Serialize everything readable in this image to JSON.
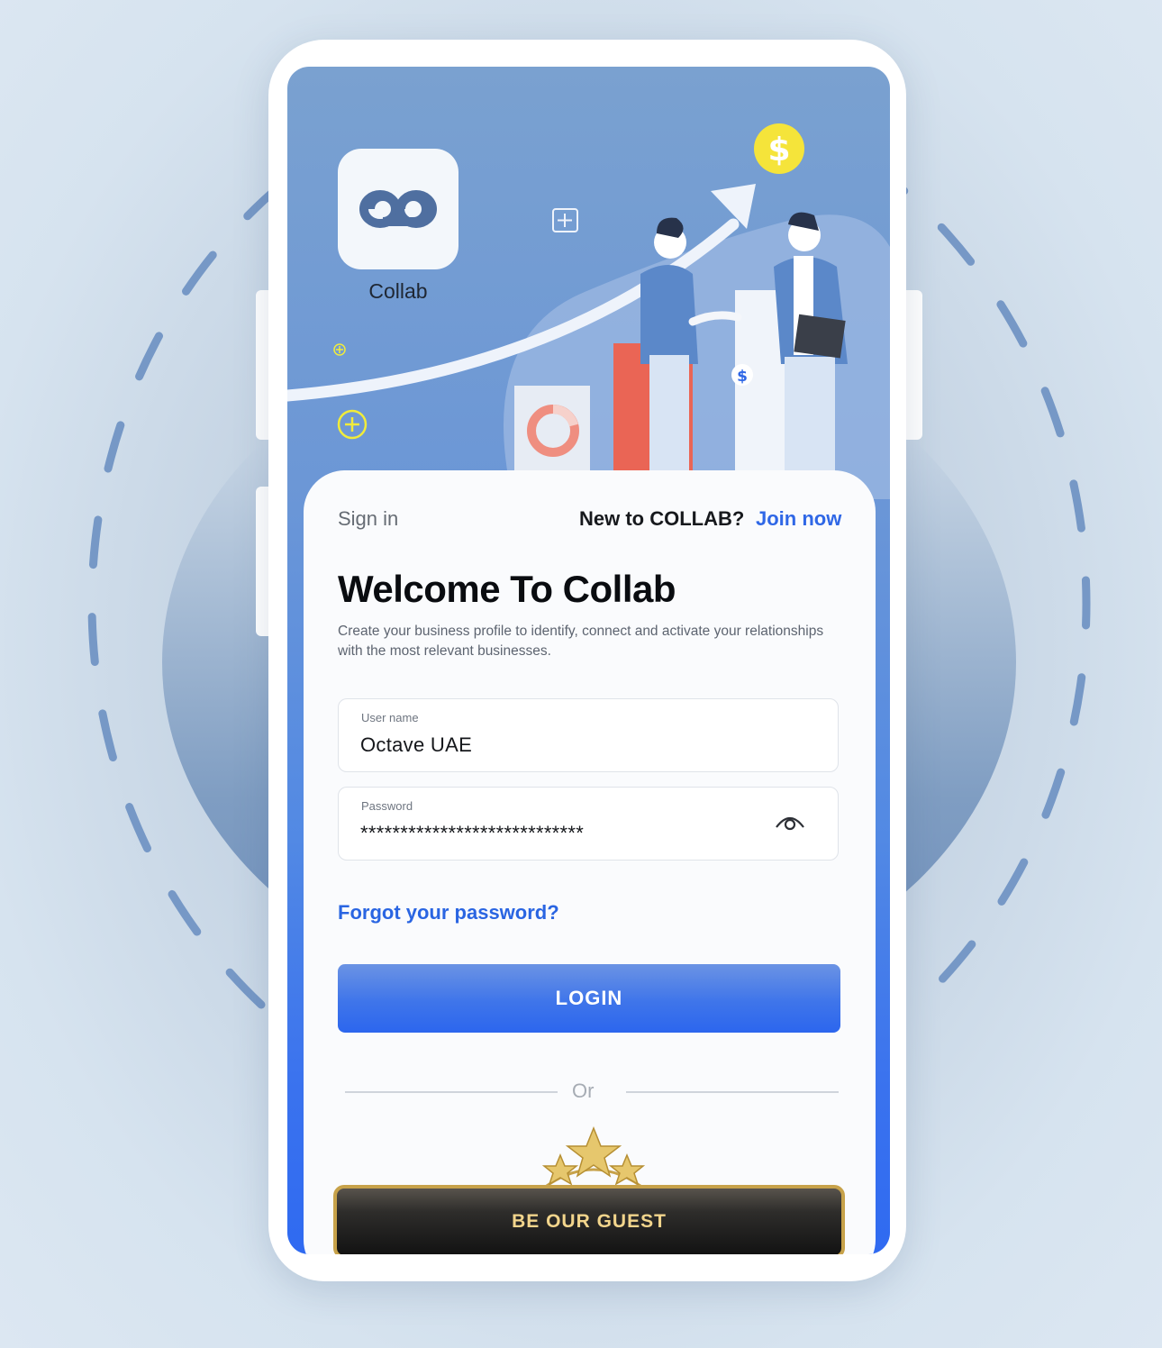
{
  "app": {
    "icon_name": "infinity-link-icon",
    "label": "Collab"
  },
  "header": {
    "sign_in": "Sign in",
    "new_to": "New to COLLAB?",
    "join_now": "Join now"
  },
  "welcome": {
    "title": "Welcome To Collab",
    "subtitle": "Create your business profile to identify, connect and activate your relationships with the most relevant businesses."
  },
  "form": {
    "username": {
      "label": "User name",
      "value": "Octave UAE"
    },
    "password": {
      "label": "Password",
      "value": "****************************",
      "toggle_icon": "eye-icon"
    }
  },
  "forgot_password": "Forgot your password?",
  "login_label": "LOGIN",
  "divider_text": "Or",
  "guest_label": "BE OUR GUEST",
  "colors": {
    "accent": "#2f67e6",
    "login_top": "#6b93e4",
    "login_bottom": "#2c66ee",
    "gold": "#c7a24a",
    "coin": "#f5e43a"
  }
}
